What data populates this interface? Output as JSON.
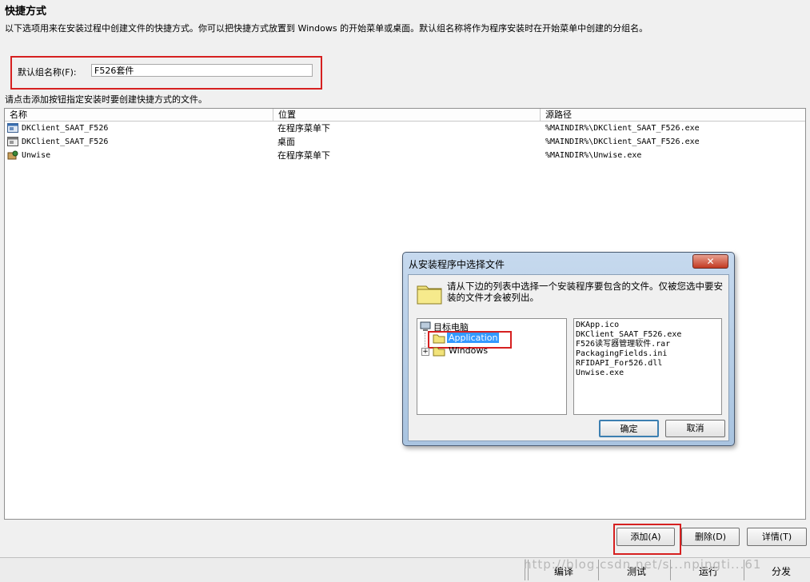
{
  "page": {
    "title": "快捷方式",
    "description": "以下选项用来在安装过程中创建文件的快捷方式。你可以把快捷方式放置到 Windows 的开始菜单或桌面。默认组名称将作为程序安装时在开始菜单中创建的分组名。",
    "group_label": "默认组名称(F):",
    "group_value": "F526套件",
    "instruction": "请点击添加按钮指定安装时要创建快捷方式的文件。"
  },
  "table": {
    "headers": [
      "名称",
      "位置",
      "源路径"
    ],
    "rows": [
      {
        "name": "DKClient_SAAT_F526",
        "location": "在程序菜单下",
        "path": "%MAINDIR%\\DKClient_SAAT_F526.exe",
        "icon": "app-window-icon"
      },
      {
        "name": "DKClient_SAAT_F526",
        "location": "桌面",
        "path": "%MAINDIR%\\DKClient_SAAT_F526.exe",
        "icon": "app-window-icon"
      },
      {
        "name": "Unwise",
        "location": "在程序菜单下",
        "path": "%MAINDIR%\\Unwise.exe",
        "icon": "uninstall-icon"
      }
    ]
  },
  "buttons": {
    "add": "添加(A)",
    "delete": "删除(D)",
    "details": "详情(T)"
  },
  "bottom_bar": {
    "compile": "编译",
    "test": "测试",
    "run": "运行",
    "distribute": "分发",
    "watermark": "http://blog.csdn.net/s...npingti...61"
  },
  "dialog": {
    "title": "从安装程序中选择文件",
    "close": "✕",
    "message": "请从下边的列表中选择一个安装程序要包含的文件。仅被您选中要安装的文件才会被列出。",
    "tree": {
      "root": "目标电脑",
      "children": [
        "Application",
        "Windows"
      ]
    },
    "files": [
      "DKApp.ico",
      "DKClient_SAAT_F526.exe",
      "F526读写器管理软件.rar",
      "PackagingFields.ini",
      "RFIDAPI_For526.dll",
      "Unwise.exe"
    ],
    "ok": "确定",
    "cancel": "取消"
  },
  "colors": {
    "highlight_border": "#d62020",
    "selection": "#3399ff",
    "dialog_frame": "#b4cce6"
  }
}
